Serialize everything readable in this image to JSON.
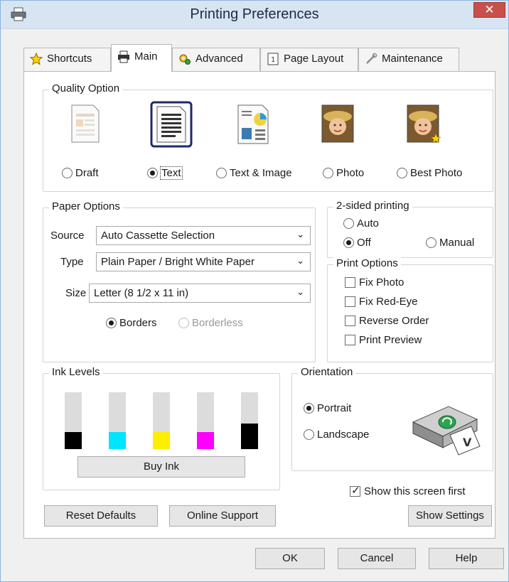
{
  "window": {
    "title": "Printing Preferences",
    "close_glyph": "✕"
  },
  "tabs": [
    {
      "label": "Shortcuts",
      "icon": "star-icon"
    },
    {
      "label": "Main",
      "icon": "printer-icon",
      "active": true
    },
    {
      "label": "Advanced",
      "icon": "gears-icon"
    },
    {
      "label": "Page Layout",
      "icon": "page-number-icon"
    },
    {
      "label": "Maintenance",
      "icon": "wrench-icon"
    }
  ],
  "quality": {
    "title": "Quality Option",
    "options": [
      {
        "label": "Draft",
        "selected": false
      },
      {
        "label": "Text",
        "selected": true
      },
      {
        "label": "Text & Image",
        "selected": false
      },
      {
        "label": "Photo",
        "selected": false
      },
      {
        "label": "Best Photo",
        "selected": false
      }
    ]
  },
  "paper": {
    "title": "Paper Options",
    "source_label": "Source",
    "source_value": "Auto Cassette Selection",
    "type_label": "Type",
    "type_value": "Plain Paper / Bright White Paper",
    "size_label": "Size",
    "size_value": "Letter (8 1/2 x 11 in)",
    "borders_label": "Borders",
    "borderless_label": "Borderless",
    "dropdown_glyph": "⌄"
  },
  "two_sided": {
    "title": "2-sided printing",
    "auto_label": "Auto",
    "off_label": "Off",
    "manual_label": "Manual",
    "selected": "Off"
  },
  "print_options": {
    "title": "Print Options",
    "items": [
      {
        "label": "Fix Photo",
        "checked": false
      },
      {
        "label": "Fix Red-Eye",
        "checked": false
      },
      {
        "label": "Reverse Order",
        "checked": false
      },
      {
        "label": "Print Preview",
        "checked": false
      }
    ]
  },
  "ink": {
    "title": "Ink Levels",
    "buy_label": "Buy Ink",
    "cartridges": [
      {
        "color": "#000000",
        "level": 0.3
      },
      {
        "color": "#00e5ff",
        "level": 0.3
      },
      {
        "color": "#ffee00",
        "level": 0.3
      },
      {
        "color": "#ff00ff",
        "level": 0.3
      },
      {
        "color": "#000000",
        "level": 0.45
      }
    ]
  },
  "orientation": {
    "title": "Orientation",
    "portrait_label": "Portrait",
    "landscape_label": "Landscape",
    "selected": "Portrait"
  },
  "show_first": {
    "label": "Show this screen first",
    "checked": true
  },
  "buttons": {
    "reset": "Reset Defaults",
    "online": "Online Support",
    "show_settings": "Show Settings",
    "ok": "OK",
    "cancel": "Cancel",
    "help": "Help"
  }
}
